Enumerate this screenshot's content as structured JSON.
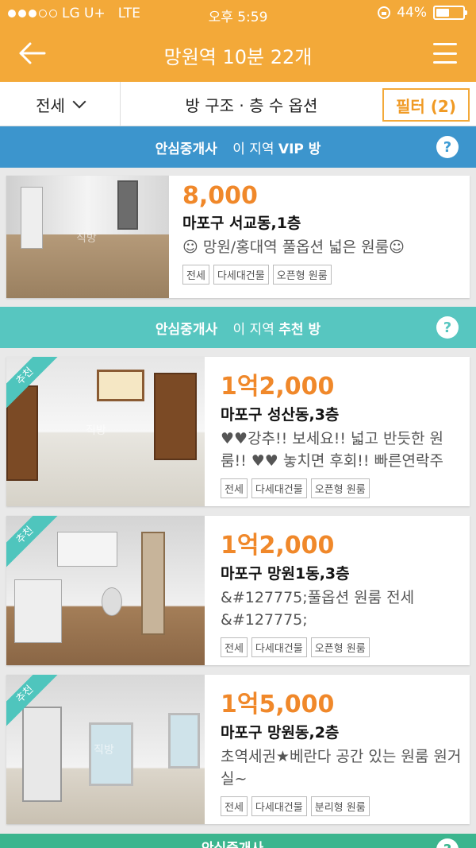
{
  "status_bar": {
    "carrier": "LG U+",
    "network": "LTE",
    "time": "오후 5:59",
    "battery": "44%",
    "battery_level": 0.44
  },
  "header": {
    "title": "망원역 10분 22개"
  },
  "filter_bar": {
    "type": "전세",
    "options_label": "방 구조 · 층 수 옵션",
    "filter_button": "필터 (2)"
  },
  "sections": {
    "vip": {
      "brand": "안심중개사",
      "text": "이 지역",
      "emphasis": "VIP 방",
      "help": "?",
      "color": "#3c95cd"
    },
    "recommended": {
      "brand": "안심중개사",
      "text": "이 지역",
      "emphasis": "추천 방",
      "help": "?",
      "color": "#57c6c0"
    },
    "bottom": {
      "brand": "안심중개사",
      "help": "?"
    }
  },
  "watermark": "직방",
  "badge_label": "추천",
  "listings": [
    {
      "price": "8,000",
      "location": "마포구 서교동,1층",
      "description": "☺ 망원/홍대역 풀옵션 넓은 원룸☺",
      "tags": [
        "전세",
        "다세대건물",
        "오픈형 원룸"
      ]
    },
    {
      "price": "1억2,000",
      "location": "마포구 성산동,3층",
      "description": "♥♥강추!! 보세요!! 넓고 반듯한 원룸!! ♥♥ 놓치면 후회!!  빠른연락주",
      "tags": [
        "전세",
        "다세대건물",
        "오픈형 원룸"
      ]
    },
    {
      "price": "1억2,000",
      "location": "마포구 망원1동,3층",
      "description": "&#127775;풀옵션 원룸 전세 &#127775;",
      "tags": [
        "전세",
        "다세대건물",
        "오픈형 원룸"
      ]
    },
    {
      "price": "1억5,000",
      "location": "마포구 망원동,2층",
      "description": "초역세권★베란다 공간 있는 원룸 원거실~",
      "tags": [
        "전세",
        "다세대건물",
        "분리형 원룸"
      ]
    }
  ],
  "colors": {
    "header": "#f3a939",
    "price": "#f0882a",
    "vip": "#3c95cd",
    "recommended": "#57c6c0"
  }
}
